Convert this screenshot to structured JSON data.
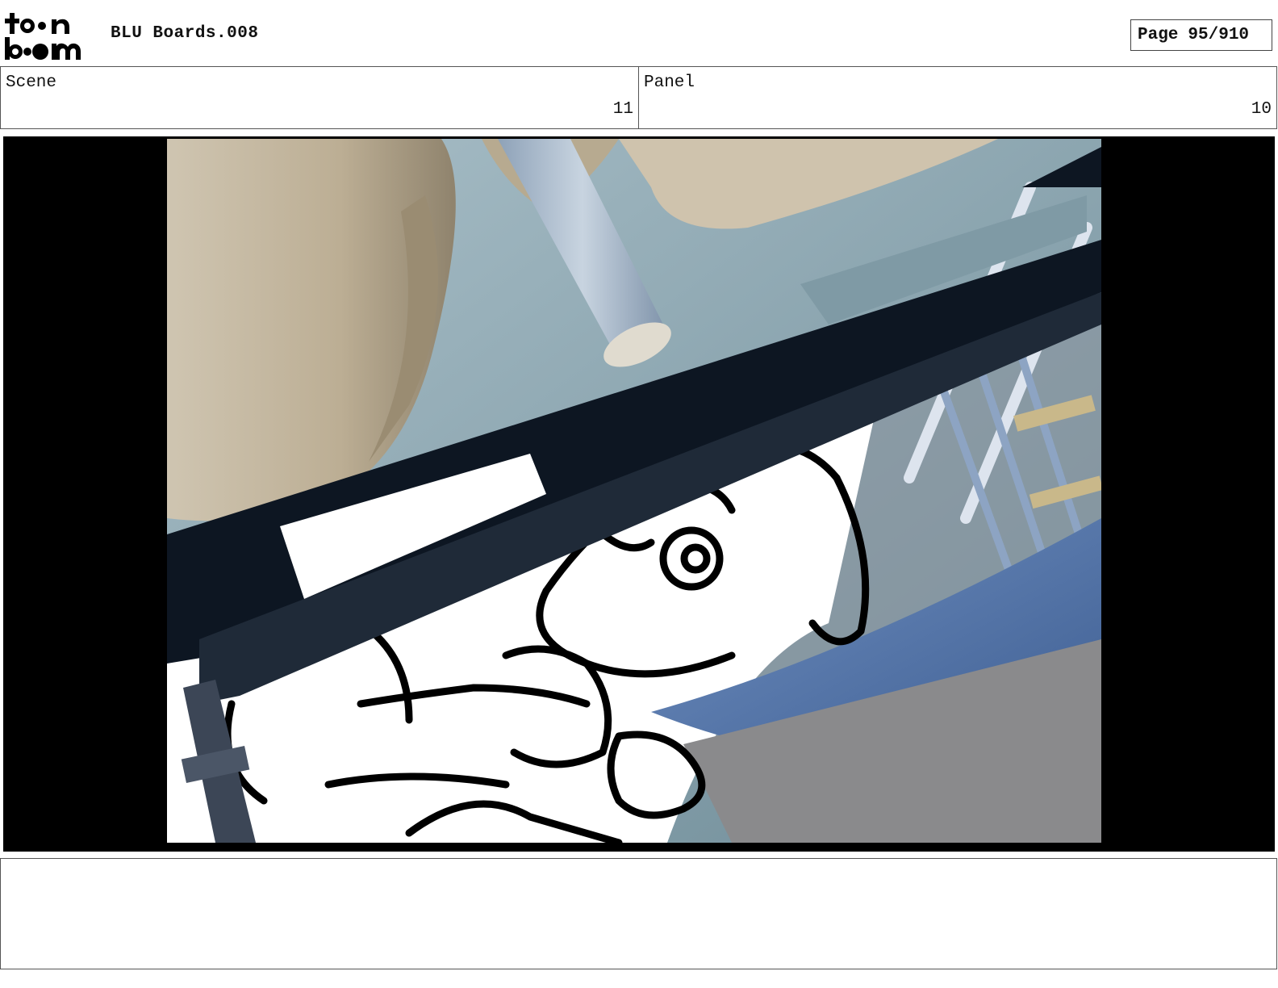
{
  "header": {
    "logo_text_top": "toon",
    "logo_text_bottom": "boom",
    "title": "BLU Boards.008",
    "page_label": "Page",
    "page_number": "95/910"
  },
  "info": {
    "scene_label": "Scene",
    "scene_value": "11",
    "panel_label": "Panel",
    "panel_value": "10"
  },
  "panel_image": {
    "icon": "storyboard-panel-image"
  },
  "notes": {
    "text": ""
  }
}
